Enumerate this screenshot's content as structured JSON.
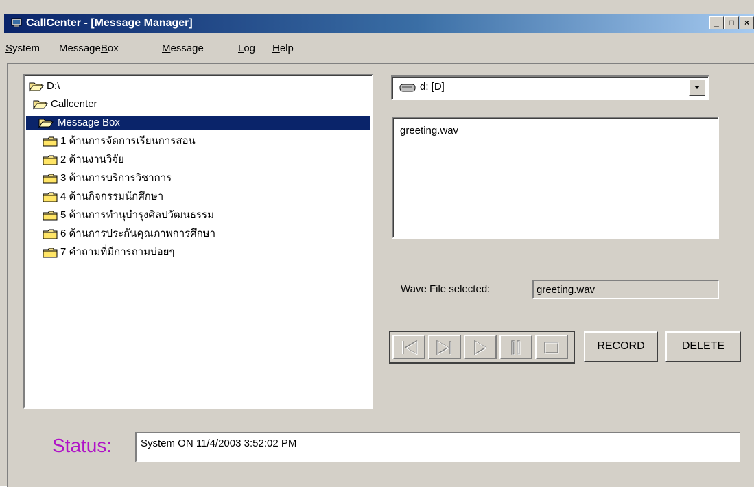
{
  "window": {
    "title": "CallCenter - [Message Manager]",
    "controls": {
      "minimize": "_",
      "maximize": "□",
      "close": "×"
    }
  },
  "menu": [
    {
      "pre": "",
      "u": "S",
      "post": "ystem"
    },
    {
      "pre": "Message",
      "u": "B",
      "post": "ox"
    },
    {
      "pre": "",
      "u": "M",
      "post": "essage"
    },
    {
      "pre": "",
      "u": "L",
      "post": "og"
    },
    {
      "pre": "",
      "u": "H",
      "post": "elp"
    }
  ],
  "tree": {
    "nodes": [
      {
        "label": "D:\\",
        "icon": "open-folder-icon"
      },
      {
        "label": "Callcenter",
        "icon": "open-folder-icon"
      },
      {
        "label": "Message Box",
        "icon": "open-folder-icon",
        "selected": true
      },
      {
        "label": "1 ด้านการจัดการเรียนการสอน",
        "icon": "folder-icon"
      },
      {
        "label": "2 ด้านงานวิจัย",
        "icon": "folder-icon"
      },
      {
        "label": "3 ด้านการบริการวิชาการ",
        "icon": "folder-icon"
      },
      {
        "label": "4 ด้านกิจกรรมนักศึกษา",
        "icon": "folder-icon"
      },
      {
        "label": "5 ด้านการทำนุบำรุงศิลปวัฒนธรรม",
        "icon": "folder-icon"
      },
      {
        "label": "6 ด้านการประกันคุณภาพการศึกษา",
        "icon": "folder-icon"
      },
      {
        "label": "7 คำถามที่มีการถามบ่อยๆ",
        "icon": "folder-icon"
      }
    ]
  },
  "drive": {
    "value": "d: [D]",
    "icon": "drive-icon"
  },
  "files": [
    "greeting.wav"
  ],
  "wave": {
    "label": "Wave File selected:",
    "value": "greeting.wav"
  },
  "transport": [
    "previous-icon",
    "next-icon",
    "play-icon",
    "pause-icon",
    "stop-icon"
  ],
  "buttons": {
    "record": "RECORD",
    "delete": "DELETE"
  },
  "status": {
    "label": "Status:",
    "text": "System ON 11/4/2003 3:52:02 PM"
  },
  "colors": {
    "title_start": "#0a246a",
    "title_end": "#a6caf0",
    "status_label": "#b013c8",
    "selection": "#0a246a",
    "face": "#d4d0c8"
  }
}
